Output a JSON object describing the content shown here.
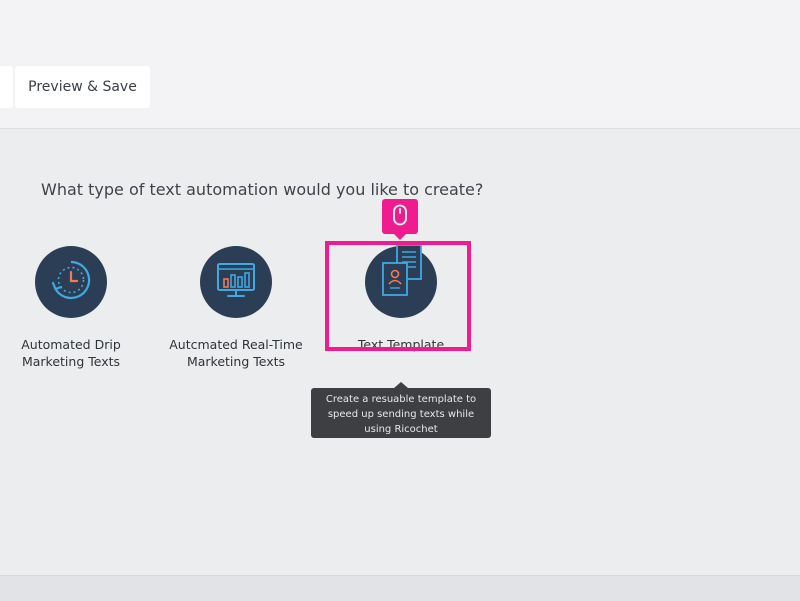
{
  "header": {
    "tabs": [
      {
        "label": "Preview & Save"
      }
    ]
  },
  "main": {
    "question": "What type of text automation would you like to create?",
    "options": [
      {
        "label_line1": "Automated Drip",
        "label_line2": "Marketing Texts",
        "icon": "clock-cycle-icon"
      },
      {
        "label_line1": "Autcmated Real-Time",
        "label_line2": "Marketing Texts",
        "icon": "monitor-chart-icon"
      },
      {
        "label_line1": "Text Template",
        "icon": "document-template-icon"
      }
    ],
    "tooltip": "Create a resuable template to speed up sending texts while using Ricochet"
  },
  "colors": {
    "accent_highlight": "#ee1c8f",
    "icon_circle": "#2c3e55",
    "icon_blue": "#3fa9e0",
    "icon_orange": "#f07b55",
    "tooltip_bg": "#3d3f42"
  }
}
